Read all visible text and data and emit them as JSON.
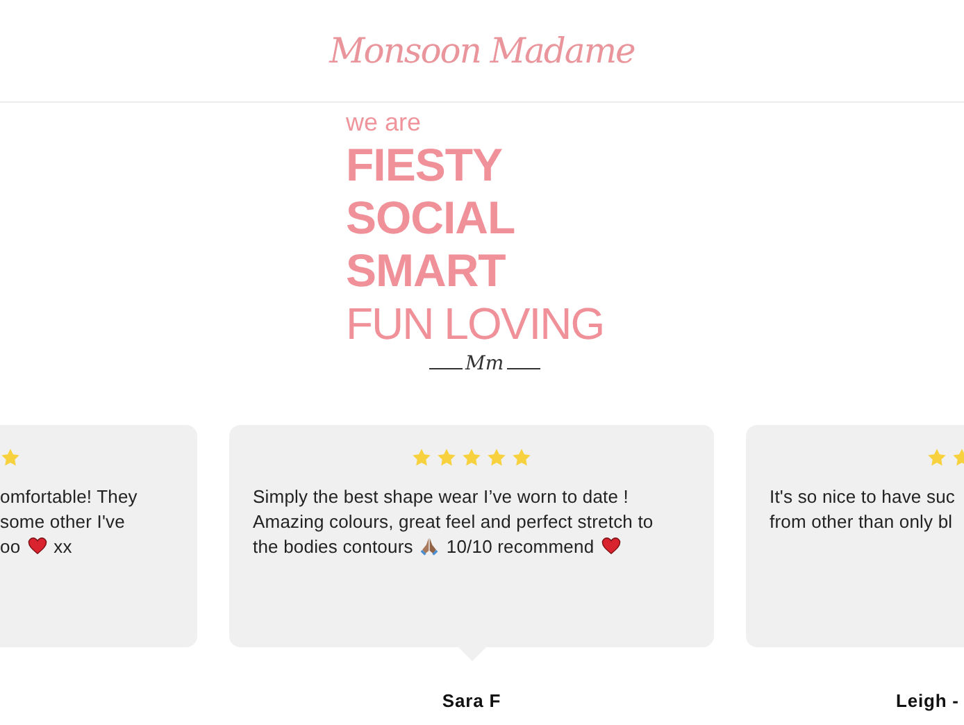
{
  "header": {
    "logo": "Monsoon Madame"
  },
  "hero": {
    "intro": "we are",
    "bold_lines": [
      "FIESTY",
      "SOCIAL",
      "SMART"
    ],
    "light_line": "FUN LOVING",
    "signature": "Mm"
  },
  "reviews": [
    {
      "kind": "cut-left",
      "selected": false,
      "lines": [
        [
          {
            "kind": "text",
            "text": "omfortable! They"
          }
        ],
        [
          {
            "kind": "text",
            "text": "some other I've"
          }
        ],
        [
          {
            "kind": "text",
            "text": "oo"
          },
          {
            "kind": "heart"
          },
          {
            "kind": "text",
            "text": "xx"
          }
        ]
      ]
    },
    {
      "kind": "full",
      "selected": true,
      "stars": 5,
      "author": "Sara F",
      "lines": [
        [
          {
            "kind": "text",
            "text": "Simply the best shape wear I’ve worn to date !"
          }
        ],
        [
          {
            "kind": "text",
            "text": "Amazing colours, great feel and perfect stretch to"
          }
        ],
        [
          {
            "kind": "text",
            "text": "the bodies contours"
          },
          {
            "kind": "hands"
          },
          {
            "kind": "text",
            "text": "10/10 recommend"
          },
          {
            "kind": "heart"
          }
        ]
      ]
    },
    {
      "kind": "cut-right",
      "selected": false,
      "author": "Leigh -",
      "lines": [
        [
          {
            "kind": "text",
            "text": "It's so nice to have suc"
          }
        ],
        [
          {
            "kind": "text",
            "text": "from other than only bl"
          }
        ]
      ]
    }
  ]
}
